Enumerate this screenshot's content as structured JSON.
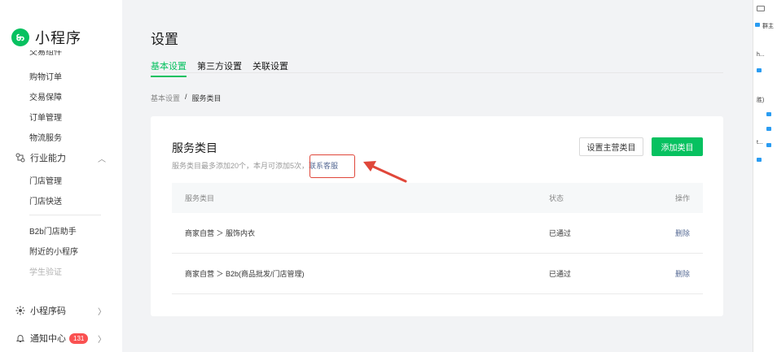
{
  "app": {
    "title": "小程序"
  },
  "sidebar": {
    "cut_item": "交易组件",
    "items": [
      {
        "label": "购物订单"
      },
      {
        "label": "交易保障"
      },
      {
        "label": "订单管理"
      },
      {
        "label": "物流服务"
      }
    ],
    "group_industry": {
      "label": "行业能力",
      "icon": "industry-icon"
    },
    "industry_items": [
      {
        "label": "门店管理"
      },
      {
        "label": "门店快送"
      }
    ],
    "extra_items": [
      {
        "label": "B2b门店助手"
      },
      {
        "label": "附近的小程序"
      },
      {
        "label": "学生验证"
      }
    ],
    "group_code": {
      "label": "小程序码"
    },
    "group_notice": {
      "label": "通知中心",
      "badge": "131"
    }
  },
  "page": {
    "title": "设置",
    "tabs": [
      {
        "label": "基本设置",
        "active": true
      },
      {
        "label": "第三方设置",
        "active": false
      },
      {
        "label": "关联设置",
        "active": false
      }
    ],
    "breadcrumb": {
      "parent": "基本设置",
      "separator": "/",
      "current": "服务类目"
    }
  },
  "card": {
    "title": "服务类目",
    "desc": "服务类目最多添加20个，本月可添加5次，",
    "link": "联系客服",
    "btn_set_main": "设置主营类目",
    "btn_add": "添加类目",
    "table": {
      "headers": [
        "服务类目",
        "状态",
        "操作"
      ],
      "rows": [
        {
          "category": "商家自营 ＞ 服饰内衣",
          "status": "已通过",
          "action": "删除"
        },
        {
          "category": "商家自营 ＞ B2b(商品批发/门店管理)",
          "status": "已通过",
          "action": "删除"
        }
      ]
    }
  },
  "right_panel": {
    "items": [
      "群主",
      "h...",
      "胜)",
      "t..."
    ]
  },
  "colors": {
    "accent": "#07c160",
    "link": "#576b95",
    "annotation": "#e0473a",
    "badge": "#fa5151"
  }
}
